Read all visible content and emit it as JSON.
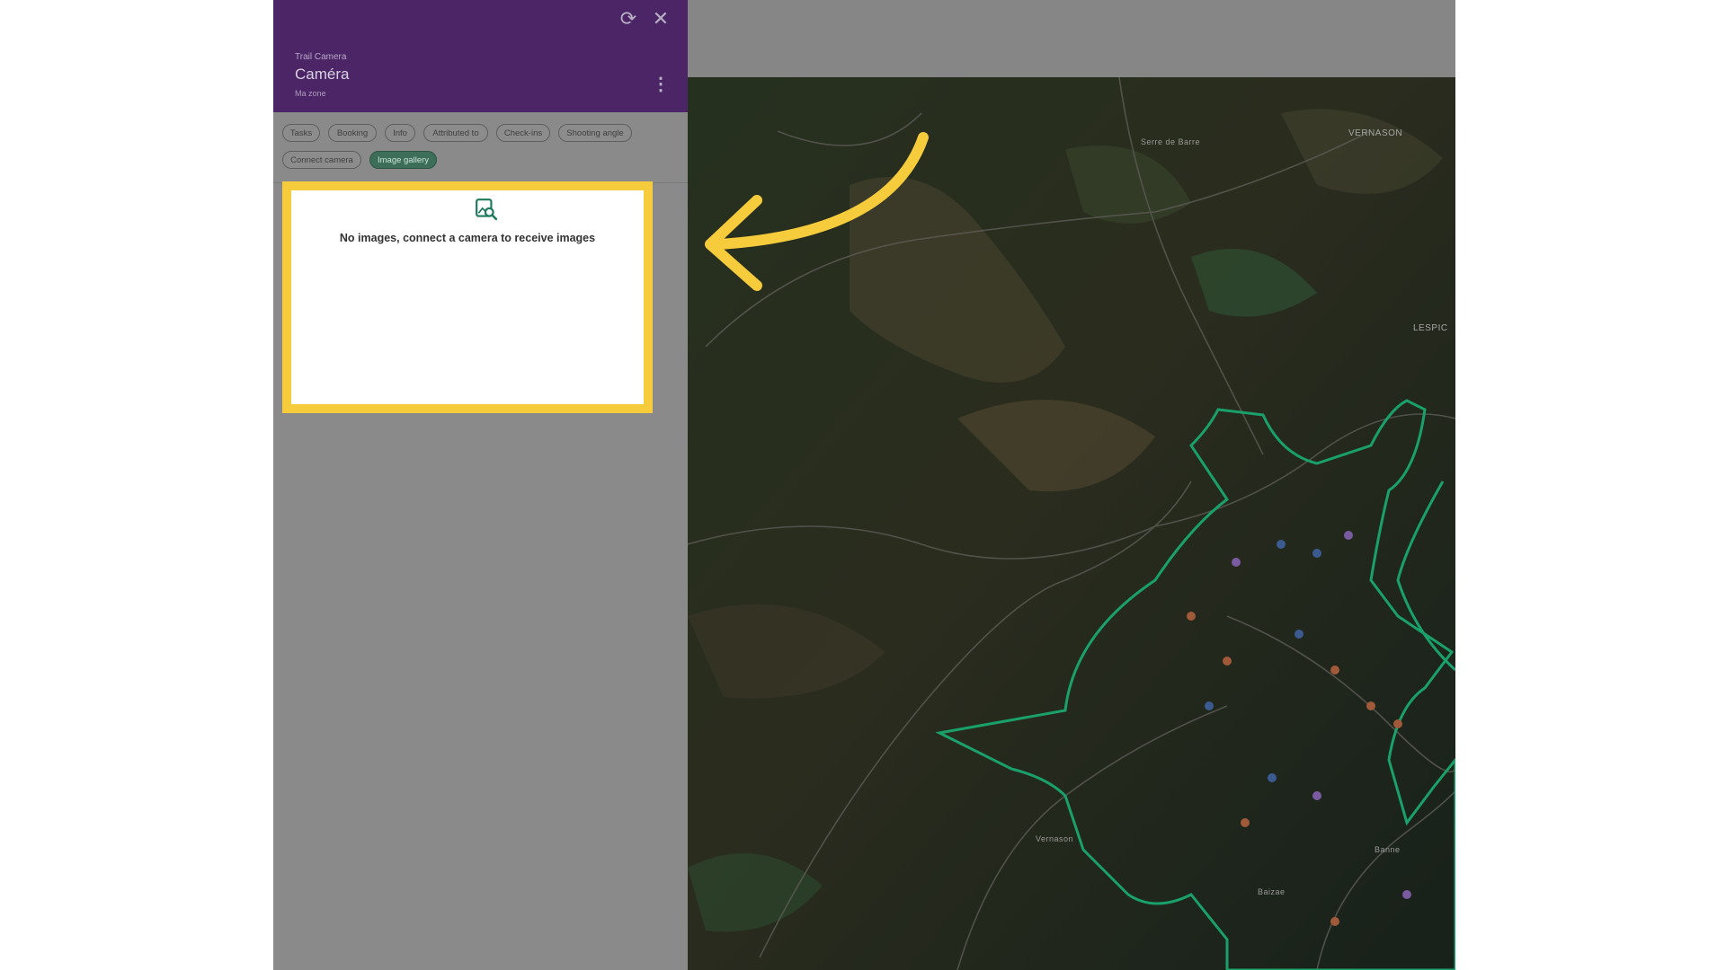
{
  "panel": {
    "subtitle": "Trail Camera",
    "title": "Caméra",
    "zone": "Ma zone",
    "icons": {
      "refresh": "refresh-icon",
      "close": "close-icon",
      "more": "more-vertical-icon"
    },
    "header_color": "#4b2566"
  },
  "tabs": [
    {
      "label": "Tasks",
      "active": false
    },
    {
      "label": "Booking",
      "active": false
    },
    {
      "label": "Info",
      "active": false
    },
    {
      "label": "Attributed to",
      "active": false
    },
    {
      "label": "Check-ins",
      "active": false
    },
    {
      "label": "Shooting angle",
      "active": false
    },
    {
      "label": "Connect camera",
      "active": false
    },
    {
      "label": "Image gallery",
      "active": true
    }
  ],
  "gallery": {
    "empty_text": "No images, connect a camera to receive images",
    "icon": "image-search-icon",
    "highlight_color": "#f7cc3c"
  },
  "map": {
    "labels": {
      "vernason_top": "VERNASON",
      "serre": "Serre de Barre",
      "lespic": "LESPIC",
      "vernason": "Vernason",
      "banne": "Banne",
      "baizae": "Baizae"
    },
    "boundary_color": "#1aa06a"
  },
  "annotation": {
    "arrow_color": "#f7cc3c",
    "arrow_icon": "curved-arrow-icon"
  }
}
